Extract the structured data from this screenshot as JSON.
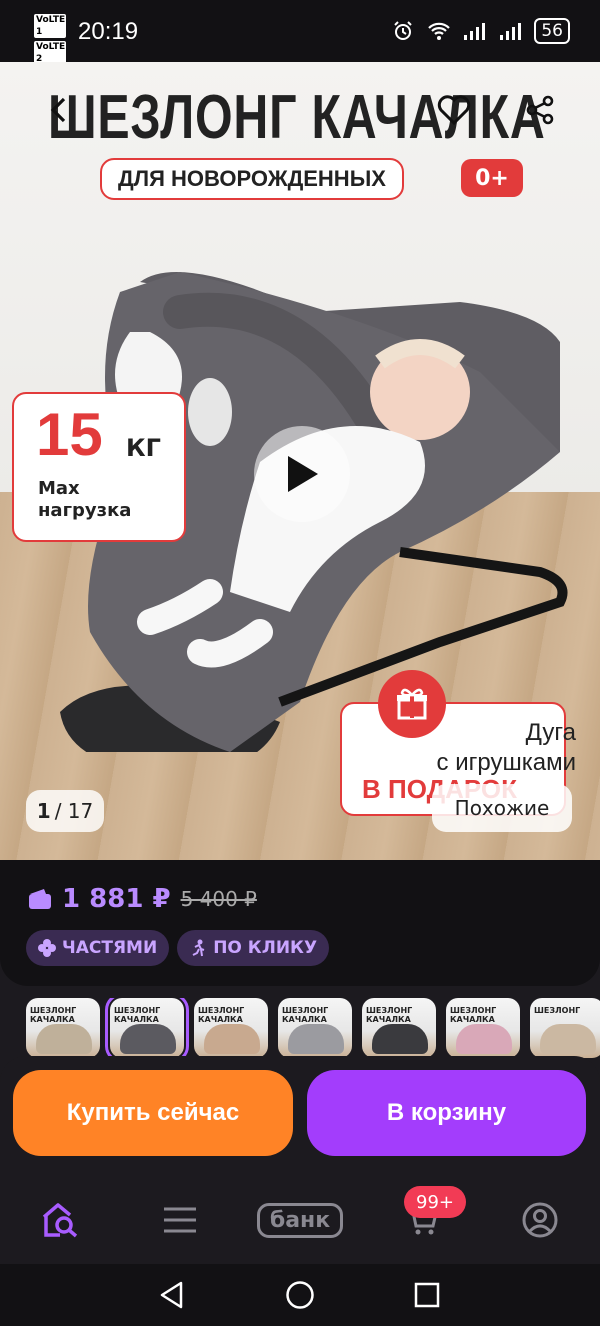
{
  "status_bar": {
    "volte1": "VoLTE 1",
    "volte2": "VoLTE 2",
    "time": "20:19",
    "battery": "56"
  },
  "hero": {
    "title": "ШЕЗЛОНГ КАЧАЛКА",
    "subtitle": "ДЛЯ НОВОРОЖДЕННЫХ",
    "age": "0+",
    "load_value": "15",
    "load_unit": "КГ",
    "load_text_line1": "Max",
    "load_text_line2": "нагрузка",
    "gift_line1": "Дуга",
    "gift_line2": "с игрушками",
    "gift_highlight": "В ПОДАРОК",
    "counter_current": "1",
    "counter_total": "/ 17",
    "similar_label": "Похожие"
  },
  "price": {
    "current": "1 881 ₽",
    "old": "5 400 ₽",
    "badge_installments": "ЧАСТЯМИ",
    "badge_click": "ПО КЛИКУ"
  },
  "thumbnails": [
    {
      "title": "ШЕЗЛОНГ КАЧАЛКА",
      "color": "#bfb09a"
    },
    {
      "title": "ШЕЗЛОНГ КАЧАЛКА",
      "color": "#5b5a60"
    },
    {
      "title": "ШЕЗЛОНГ КАЧАЛКА",
      "color": "#c8a98f"
    },
    {
      "title": "ШЕЗЛОНГ КАЧАЛКА",
      "color": "#9b9ba0"
    },
    {
      "title": "ШЕЗЛОНГ КАЧАЛКА",
      "color": "#3a3a3e"
    },
    {
      "title": "ШЕЗЛОНГ КАЧАЛКА",
      "color": "#d9a8b8"
    },
    {
      "title": "ШЕЗЛОНГ",
      "color": "#cbb8a2"
    }
  ],
  "actions": {
    "buy_now": "Купить сейчас",
    "add_to_cart": "В корзину"
  },
  "tabbar": {
    "bank": "банк",
    "cart_badge": "99+"
  },
  "colors": {
    "accent_purple": "#a33dfc",
    "accent_orange": "#ff8326",
    "promo_red": "#e23b3b",
    "price_purple": "#b98bff"
  }
}
